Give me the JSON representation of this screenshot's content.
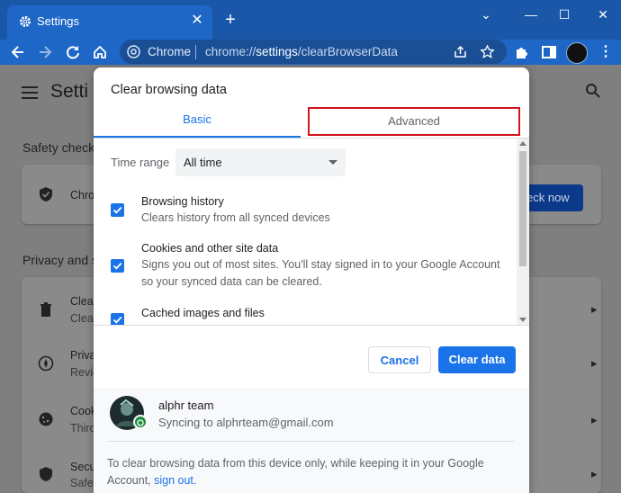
{
  "browser": {
    "tab_title": "Settings",
    "omnibox_site": "Chrome",
    "omnibox_url_prefix": "chrome://",
    "omnibox_url_host": "settings",
    "omnibox_url_path": "/clearBrowserData"
  },
  "settings_page": {
    "title": "Setti",
    "safety_heading": "Safety check",
    "safety_card_text": "Chro",
    "safety_button": "eck now",
    "privacy_heading": "Privacy and s",
    "rows": [
      {
        "icon": "trash-icon",
        "title": "Clear",
        "subtitle": "Clear"
      },
      {
        "icon": "privacy-guide-icon",
        "title": "Priva",
        "subtitle": "Revie"
      },
      {
        "icon": "cookie-icon",
        "title": "Cook",
        "subtitle": "Thirc"
      },
      {
        "icon": "shield-icon",
        "title": "Secu",
        "subtitle": "Safe"
      }
    ]
  },
  "dialog": {
    "title": "Clear browsing data",
    "tabs": [
      {
        "label": "Basic",
        "active": true
      },
      {
        "label": "Advanced",
        "active": false,
        "highlighted": true
      }
    ],
    "time_range_label": "Time range",
    "time_range_value": "All time",
    "options": [
      {
        "title": "Browsing history",
        "description": "Clears history from all synced devices",
        "checked": true
      },
      {
        "title": "Cookies and other site data",
        "description": "Signs you out of most sites. You'll stay signed in to your Google Account so your synced data can be cleared.",
        "checked": true
      },
      {
        "title": "Cached images and files",
        "description": "",
        "checked": true
      }
    ],
    "cancel_label": "Cancel",
    "clear_label": "Clear data",
    "account_name": "alphr team",
    "account_sync": "Syncing to alphrteam@gmail.com",
    "footer_text": "To clear browsing data from this device only, while keeping it in your Google Account,",
    "footer_link": "sign out.",
    "accent_color": "#1a73e8",
    "highlight_color": "#d3141b"
  }
}
